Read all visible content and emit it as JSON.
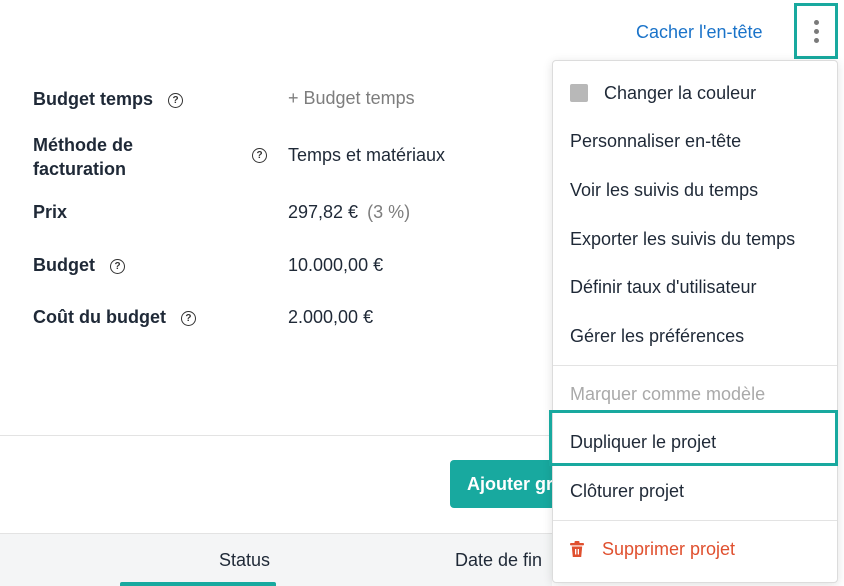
{
  "header": {
    "hide_header_link": "Cacher l'en-tête",
    "more_icon": "more-vertical-icon"
  },
  "fields": [
    {
      "label": "Budget temps",
      "value": "+ Budget temps",
      "help": "?"
    },
    {
      "label_line1": "Méthode de",
      "label_line2": "facturation",
      "value": "Temps et matériaux",
      "help": "?"
    },
    {
      "label": "Prix",
      "value": "297,82 €",
      "value_extra": "(3 %)"
    },
    {
      "label": "Budget",
      "value": "10.000,00 €",
      "help": "?"
    },
    {
      "label": "Coût du budget",
      "value": "2.000,00 €",
      "help": "?"
    }
  ],
  "actions": {
    "add_button": "Ajouter gr"
  },
  "table": {
    "headers": [
      "Status",
      "Date de fin"
    ]
  },
  "menu": {
    "items": [
      "Changer la couleur",
      "Personnaliser en-tête",
      "Voir les suivis du temps",
      "Exporter les suivis du temps",
      "Définir taux d'utilisateur",
      "Gérer les préférences",
      "Marquer comme modèle",
      "Dupliquer le projet",
      "Clôturer projet",
      "Supprimer projet"
    ]
  },
  "colors": {
    "accent": "#18a99f",
    "link": "#1a73c9",
    "danger": "#e0502f",
    "disabled": "#a9a9a9"
  }
}
